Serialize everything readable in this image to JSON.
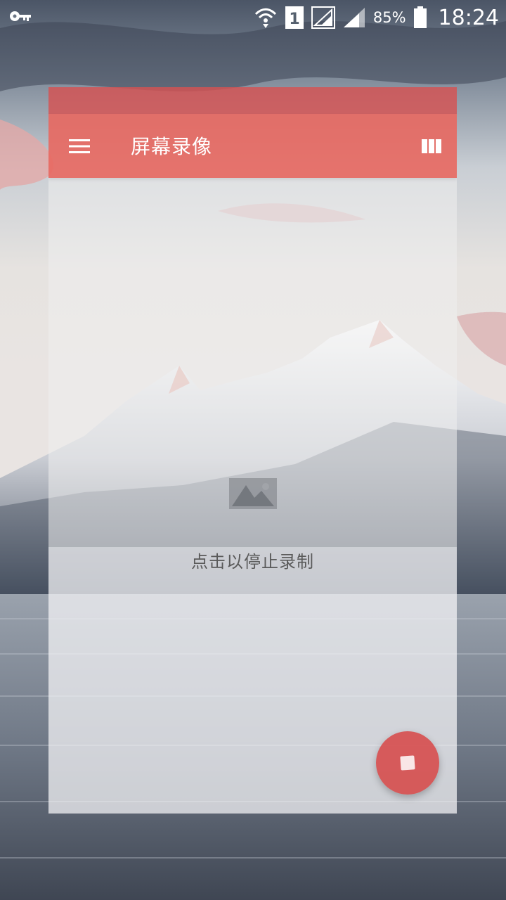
{
  "status_bar": {
    "sim_slot": "1",
    "battery_percent": "85%",
    "time": "18:24",
    "icons": [
      "key-icon",
      "wifi-icon",
      "sim-signal-icon",
      "cell-signal-icon",
      "battery-icon"
    ]
  },
  "toolbar": {
    "title": "屏幕录像",
    "menu_icon": "hamburger-menu-icon",
    "view_icon": "column-view-icon"
  },
  "main": {
    "empty_text": "点击以停止录制",
    "empty_icon": "video-placeholder-icon"
  },
  "fab": {
    "icon": "stop-icon"
  },
  "colors": {
    "toolbar": "#e86860",
    "status_strip": "#d65252",
    "fab": "#d64646",
    "empty_text": "#5a5a5a"
  }
}
